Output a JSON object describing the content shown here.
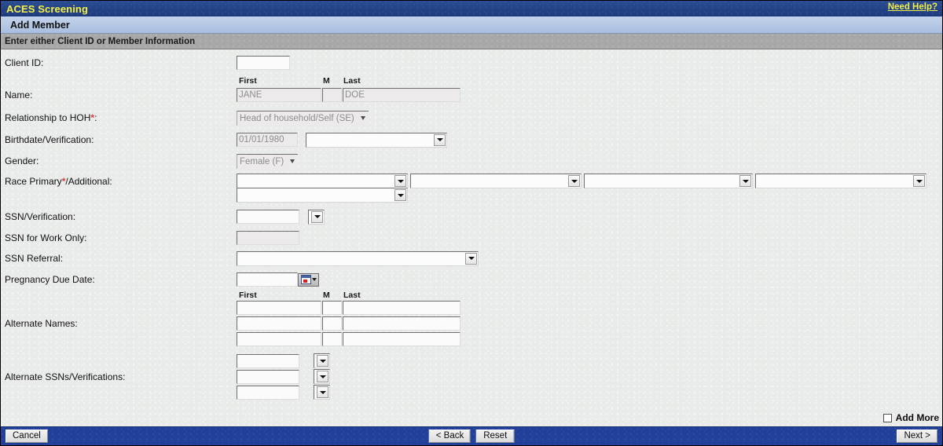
{
  "header": {
    "app_title": "ACES Screening",
    "help_link": "Need Help?",
    "page_title": "Add Member",
    "instruction": "Enter either Client ID or Member Information"
  },
  "form": {
    "client_id": {
      "label": "Client ID:",
      "value": ""
    },
    "name": {
      "label": "Name:",
      "col_first": "First",
      "col_middle": "M",
      "col_last": "Last",
      "first": "JANE",
      "middle": "",
      "last": "DOE"
    },
    "relationship": {
      "label": "Relationship to HOH",
      "required_mark": "*",
      "label_suffix": ":",
      "value": "Head of household/Self (SE)"
    },
    "birthdate": {
      "label": "Birthdate/Verification:",
      "date": "01/01/1980",
      "verification": ""
    },
    "gender": {
      "label": "Gender:",
      "value": "Female (F)"
    },
    "race": {
      "label": "Race Primary",
      "required_mark": "*",
      "label_suffix": "/Additional:",
      "primary": "",
      "additional_1": "",
      "additional_2": "",
      "additional_3": "",
      "additional_4": ""
    },
    "ssn": {
      "label": "SSN/Verification:",
      "value": "",
      "verification": ""
    },
    "ssn_work": {
      "label": "SSN for Work Only:",
      "value": ""
    },
    "ssn_referral": {
      "label": "SSN Referral:",
      "value": ""
    },
    "pregnancy": {
      "label": "Pregnancy Due Date:",
      "value": "",
      "calendar_icon": "calendar-icon"
    },
    "alt_names": {
      "label": "Alternate Names:",
      "col_first": "First",
      "col_middle": "M",
      "col_last": "Last",
      "rows": [
        {
          "first": "",
          "middle": "",
          "last": ""
        },
        {
          "first": "",
          "middle": "",
          "last": ""
        },
        {
          "first": "",
          "middle": "",
          "last": ""
        }
      ]
    },
    "alt_ssns": {
      "label": "Alternate SSNs/Verifications:",
      "rows": [
        {
          "ssn": "",
          "verification": ""
        },
        {
          "ssn": "",
          "verification": ""
        },
        {
          "ssn": "",
          "verification": ""
        }
      ]
    }
  },
  "footer": {
    "add_more_label": "Add More",
    "add_more_checked": false,
    "cancel": "Cancel",
    "back": "< Back",
    "reset": "Reset",
    "next": "Next >"
  },
  "colors": {
    "title_bar": "#21409a",
    "title_text": "#f5f043",
    "sub_bar": "#b4c6e3",
    "instruction_bar": "#a8a8a8",
    "required": "#e03c3c",
    "page_bg": "#e9eaea"
  }
}
